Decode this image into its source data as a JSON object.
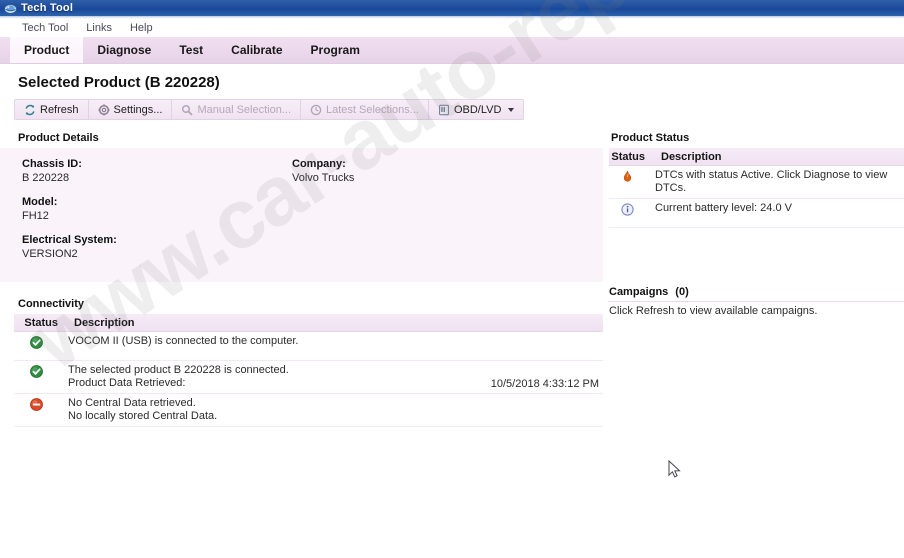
{
  "window": {
    "title": "Tech Tool",
    "icon": "app-icon"
  },
  "menubar": {
    "items": [
      {
        "label": "Tech Tool"
      },
      {
        "label": "Links"
      },
      {
        "label": "Help"
      }
    ]
  },
  "tabs": [
    {
      "label": "Product",
      "active": true
    },
    {
      "label": "Diagnose",
      "active": false
    },
    {
      "label": "Test",
      "active": false
    },
    {
      "label": "Calibrate",
      "active": false
    },
    {
      "label": "Program",
      "active": false
    }
  ],
  "page": {
    "title": "Selected Product (B 220228)"
  },
  "toolbar": {
    "buttons": [
      {
        "label": "Refresh",
        "icon": "refresh-icon",
        "disabled": false,
        "dropdown": false
      },
      {
        "label": "Settings...",
        "icon": "gear-icon",
        "disabled": false,
        "dropdown": false
      },
      {
        "label": "Manual Selection...",
        "icon": "magnifier-icon",
        "disabled": true,
        "dropdown": false
      },
      {
        "label": "Latest Selections...",
        "icon": "clock-icon",
        "disabled": true,
        "dropdown": false
      },
      {
        "label": "OBD/LVD",
        "icon": "connector-icon",
        "disabled": false,
        "dropdown": true
      }
    ]
  },
  "product_details": {
    "section_title": "Product Details",
    "fields_left": [
      {
        "label": "Chassis ID:",
        "value": "B 220228"
      },
      {
        "label": "Model:",
        "value": "FH12"
      },
      {
        "label": "Electrical System:",
        "value": "VERSION2"
      }
    ],
    "fields_right": [
      {
        "label": "Company:",
        "value": "Volvo Trucks"
      }
    ]
  },
  "product_status": {
    "section_title": "Product Status",
    "columns": {
      "status": "Status",
      "description": "Description"
    },
    "rows": [
      {
        "icon": "warning-icon",
        "icon_color": "#e06010",
        "description": "DTCs with status Active. Click Diagnose to view DTCs."
      },
      {
        "icon": "info-icon",
        "icon_color": "#7b8bc4",
        "description": "Current battery level: 24.0 V"
      }
    ]
  },
  "connectivity": {
    "section_title": "Connectivity",
    "columns": {
      "status": "Status",
      "description": "Description"
    },
    "rows": [
      {
        "icon": "check-icon",
        "icon_color": "#2e8b3f",
        "line1": "VOCOM II (USB) is connected to the computer.",
        "line2": "",
        "time": ""
      },
      {
        "icon": "check-icon",
        "icon_color": "#2e8b3f",
        "line1": "The selected product B 220228 is connected.",
        "line2": "Product Data Retrieved:",
        "time": "10/5/2018 4:33:12 PM"
      },
      {
        "icon": "blocked-icon",
        "icon_color": "#d94a28",
        "line1": "No Central Data retrieved.",
        "line2": "No locally stored Central Data.",
        "time": ""
      }
    ]
  },
  "campaigns": {
    "section_title": "Campaigns",
    "count": "(0)",
    "message": "Click Refresh to view available campaigns."
  },
  "watermark": {
    "text": "www.car-auto-repair.com"
  },
  "colors": {
    "titlebar": "#1e4e9c",
    "tabbar": "#ecd9ec",
    "panel_pink": "#fbf3fa",
    "header_strip": "#f3e7f3"
  }
}
